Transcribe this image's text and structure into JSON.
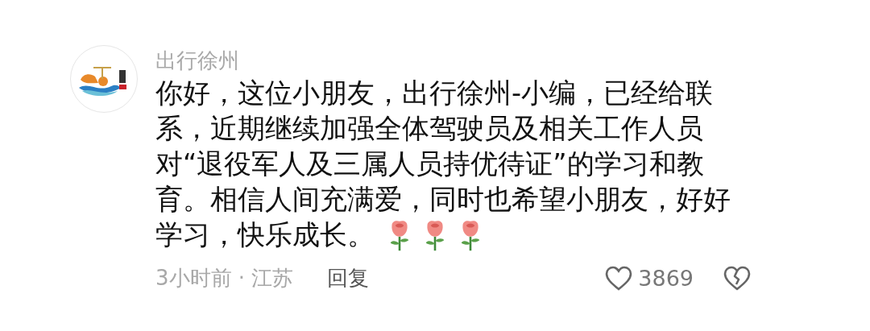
{
  "comment": {
    "author": "出行徐州",
    "text": "你好，这位小朋友，出行徐州-小编，已经给联系，近期继续加强全体驾驶员及相关工作人员对“退役军人及三属人员持优待证”的学习和教育。相信人间充满爱，同时也希望小朋友，好好学习，快乐成长。",
    "time": "3小时前 · 江苏",
    "reply": "回复",
    "likes": "3869"
  }
}
